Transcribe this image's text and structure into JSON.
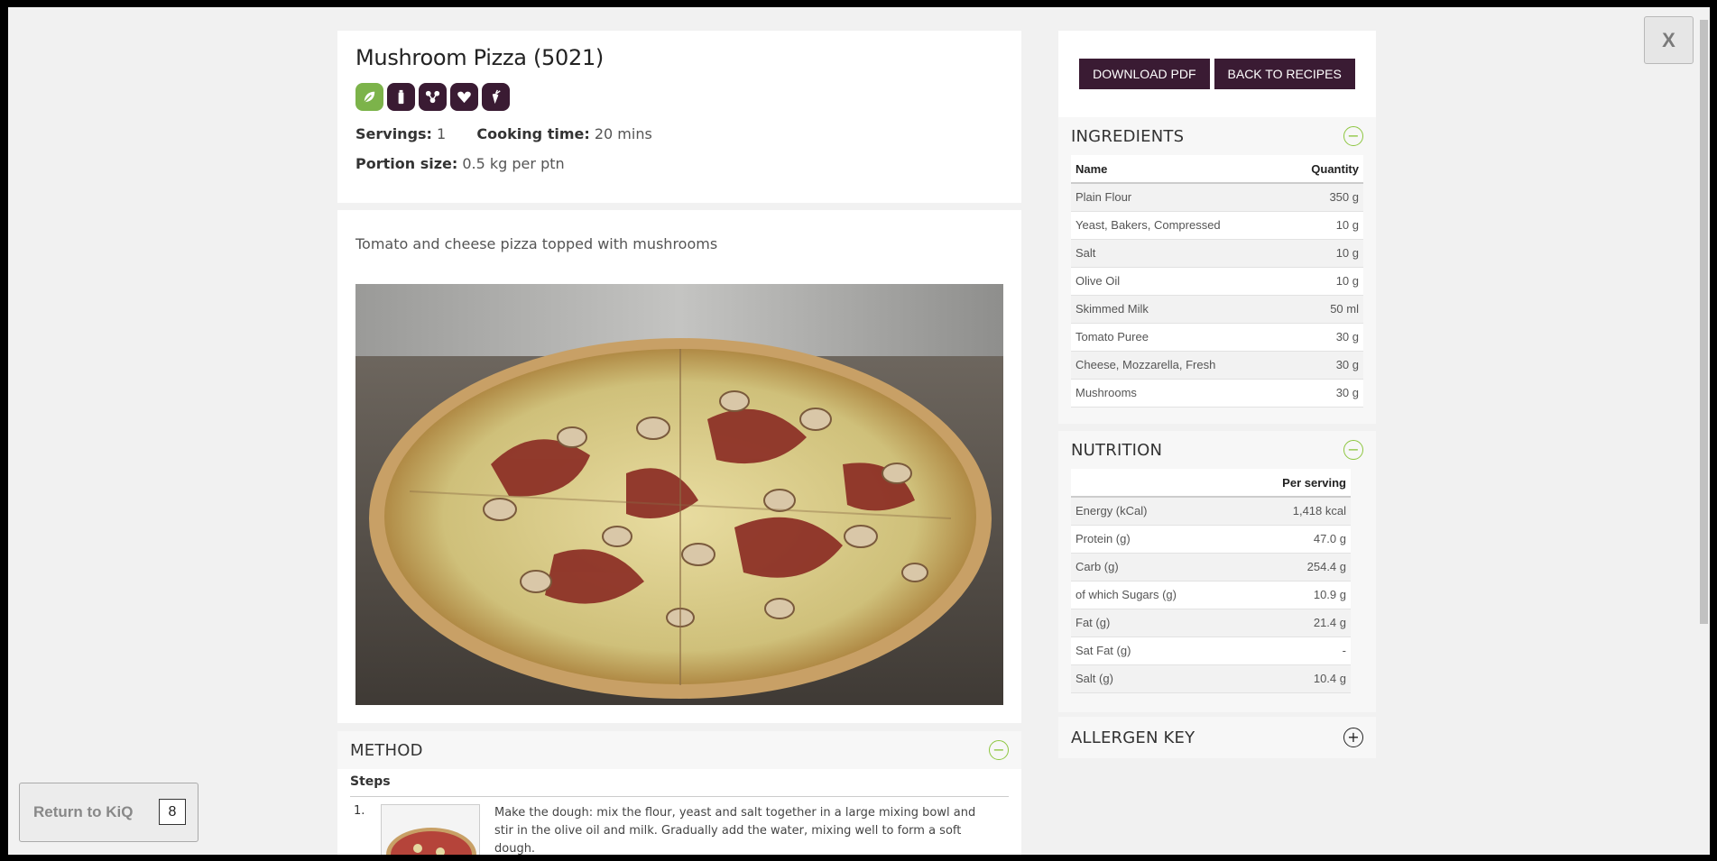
{
  "recipe": {
    "title": "Mushroom Pizza (5021)",
    "diet_icons": [
      "leaf-icon",
      "bottle-icon",
      "molecule-icon",
      "heart-icon",
      "carrot-icon"
    ],
    "servings_label": "Servings:",
    "servings_value": "1",
    "cooking_label": "Cooking time:",
    "cooking_value": "20 mins",
    "portion_label": "Portion size:",
    "portion_value": "0.5 kg per ptn",
    "description": "Tomato and cheese pizza topped with mushrooms"
  },
  "actions": {
    "download_label": "DOWNLOAD PDF",
    "back_label": "BACK TO RECIPES"
  },
  "close_label": "X",
  "ingredients": {
    "title": "INGREDIENTS",
    "toggle": "−",
    "col_name": "Name",
    "col_qty": "Quantity",
    "rows": [
      {
        "name": "Plain Flour",
        "qty": "350 g"
      },
      {
        "name": "Yeast, Bakers, Compressed",
        "qty": "10 g"
      },
      {
        "name": "Salt",
        "qty": "10 g"
      },
      {
        "name": "Olive Oil",
        "qty": "10 g"
      },
      {
        "name": "Skimmed Milk",
        "qty": "50 ml"
      },
      {
        "name": "Tomato Puree",
        "qty": "30 g"
      },
      {
        "name": "Cheese, Mozzarella, Fresh",
        "qty": "30 g"
      },
      {
        "name": "Mushrooms",
        "qty": "30 g"
      }
    ]
  },
  "nutrition": {
    "title": "NUTRITION",
    "toggle": "−",
    "col_name": "",
    "col_value": "Per serving",
    "rows": [
      {
        "name": "Energy (kCal)",
        "value": "1,418 kcal"
      },
      {
        "name": "Protein (g)",
        "value": "47.0 g"
      },
      {
        "name": "Carb (g)",
        "value": "254.4 g"
      },
      {
        "name": "of which Sugars (g)",
        "value": "10.9 g"
      },
      {
        "name": "Fat (g)",
        "value": "21.4 g"
      },
      {
        "name": "Sat Fat (g)",
        "value": "-"
      },
      {
        "name": "Salt (g)",
        "value": "10.4 g"
      }
    ]
  },
  "allergen": {
    "title": "ALLERGEN KEY",
    "toggle": "+"
  },
  "method": {
    "title": "METHOD",
    "toggle": "−",
    "steps_label": "Steps",
    "steps": [
      {
        "num": "1.",
        "text": "Make the dough: mix the flour, yeast and salt together in a large mixing bowl and stir in the olive oil and milk. Gradually add the water, mixing well to form a soft dough."
      }
    ]
  },
  "return_widget": {
    "label": "Return to KiQ",
    "count": "8"
  }
}
